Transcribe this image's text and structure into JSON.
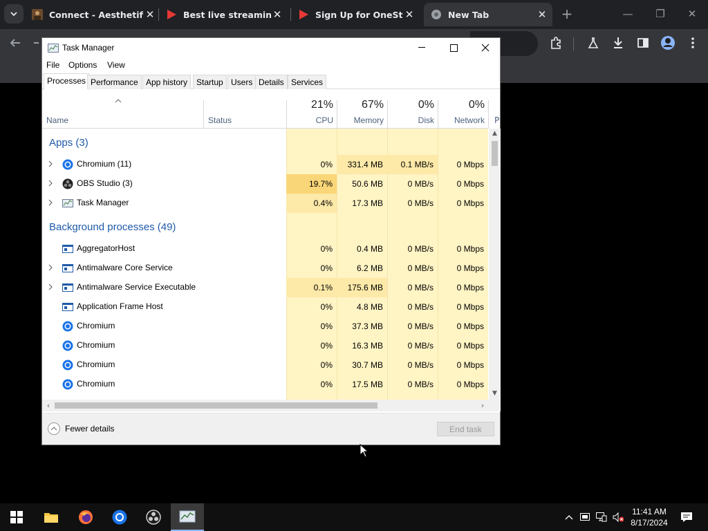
{
  "browser": {
    "tabs": [
      {
        "title": "Connect - Aesthetiful",
        "close": "✕"
      },
      {
        "title": "Best live streaming pl",
        "close": "✕"
      },
      {
        "title": "Sign Up for OneStrear",
        "close": "✕"
      },
      {
        "title": "New Tab",
        "close": "✕"
      }
    ],
    "new_tab": "+",
    "controls": {
      "minimize": "—",
      "restore": "❐",
      "close": "✕"
    },
    "toolbar_icons": [
      "back-icon",
      "forward-icon",
      "extensions-icon",
      "labs-icon",
      "download-icon",
      "side-panel-icon",
      "profile-icon",
      "menu-icon"
    ]
  },
  "taskmgr": {
    "title": "Task Manager",
    "menu": [
      "File",
      "Options",
      "View"
    ],
    "tabs": [
      "Processes",
      "Performance",
      "App history",
      "Startup",
      "Users",
      "Details",
      "Services"
    ],
    "active_tab": "Processes",
    "columns": {
      "name": "Name",
      "status": "Status",
      "cpu": {
        "pct": "21%",
        "label": "CPU"
      },
      "memory": {
        "pct": "67%",
        "label": "Memory"
      },
      "disk": {
        "pct": "0%",
        "label": "Disk"
      },
      "network": {
        "pct": "0%",
        "label": "Network"
      },
      "partial": "P"
    },
    "groups": {
      "apps": "Apps (3)",
      "background": "Background processes (49)"
    },
    "apps": [
      {
        "name": "Chromium (11)",
        "icon": "chromium-icon",
        "expandable": true,
        "cpu": "0%",
        "memory": "331.4 MB",
        "disk": "0.1 MB/s",
        "network": "0 Mbps"
      },
      {
        "name": "OBS Studio (3)",
        "icon": "obs-icon",
        "expandable": true,
        "cpu": "19.7%",
        "memory": "50.6 MB",
        "disk": "0 MB/s",
        "network": "0 Mbps"
      },
      {
        "name": "Task Manager",
        "icon": "taskmanager-icon",
        "expandable": true,
        "cpu": "0.4%",
        "memory": "17.3 MB",
        "disk": "0 MB/s",
        "network": "0 Mbps"
      }
    ],
    "background": [
      {
        "name": "AggregatorHost",
        "icon": "service-window-icon",
        "expandable": false,
        "cpu": "0%",
        "memory": "0.4 MB",
        "disk": "0 MB/s",
        "network": "0 Mbps"
      },
      {
        "name": "Antimalware Core Service",
        "icon": "service-window-icon",
        "expandable": true,
        "cpu": "0%",
        "memory": "6.2 MB",
        "disk": "0 MB/s",
        "network": "0 Mbps"
      },
      {
        "name": "Antimalware Service Executable",
        "icon": "service-window-icon",
        "expandable": true,
        "cpu": "0.1%",
        "memory": "175.6 MB",
        "disk": "0 MB/s",
        "network": "0 Mbps"
      },
      {
        "name": "Application Frame Host",
        "icon": "service-window-icon",
        "expandable": false,
        "cpu": "0%",
        "memory": "4.8 MB",
        "disk": "0 MB/s",
        "network": "0 Mbps"
      },
      {
        "name": "Chromium",
        "icon": "chromium-icon",
        "expandable": false,
        "cpu": "0%",
        "memory": "37.3 MB",
        "disk": "0 MB/s",
        "network": "0 Mbps"
      },
      {
        "name": "Chromium",
        "icon": "chromium-icon",
        "expandable": false,
        "cpu": "0%",
        "memory": "16.3 MB",
        "disk": "0 MB/s",
        "network": "0 Mbps"
      },
      {
        "name": "Chromium",
        "icon": "chromium-icon",
        "expandable": false,
        "cpu": "0%",
        "memory": "30.7 MB",
        "disk": "0 MB/s",
        "network": "0 Mbps"
      },
      {
        "name": "Chromium",
        "icon": "chromium-icon",
        "expandable": false,
        "cpu": "0%",
        "memory": "17.5 MB",
        "disk": "0 MB/s",
        "network": "0 Mbps"
      }
    ],
    "footer": {
      "fewer_details": "Fewer details",
      "end_task": "End task"
    }
  },
  "taskbar": {
    "apps": [
      "start-icon",
      "file-explorer-icon",
      "firefox-icon",
      "chromium-icon",
      "obs-icon",
      "taskmanager-icon"
    ],
    "clock_time": "11:41 AM",
    "clock_date": "8/17/2024"
  },
  "colors": {
    "heat_light": "#fff4c4",
    "heat_medium": "#fde9a8",
    "heat_strong": "#f9d678",
    "group_blue": "#1e5aa8"
  }
}
